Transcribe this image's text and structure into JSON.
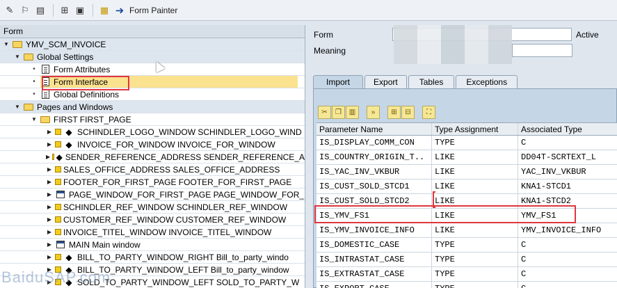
{
  "toolbar": {
    "form_painter_label": "Form Painter",
    "icons": [
      "pencil-glasses-icon",
      "activate-icon",
      "display-object-icon",
      "new-object-icon",
      "local-object-icon",
      "form-painter-icon"
    ]
  },
  "tree": {
    "header": "Form",
    "items": [
      {
        "label": "YMV_SCM_INVOICE",
        "level": 0,
        "icon": "folder-icon"
      },
      {
        "label": "Global Settings",
        "level": 1,
        "icon": "folder-icon"
      },
      {
        "label": "Form Attributes",
        "level": 2,
        "icon": "document-icon"
      },
      {
        "label": "Form Interface",
        "level": 2,
        "icon": "document-icon"
      },
      {
        "label": "Global Definitions",
        "level": 2,
        "icon": "document-icon"
      },
      {
        "label": "Pages and Windows",
        "level": 1,
        "icon": "folder-icon"
      },
      {
        "label": "FIRST FIRST_PAGE",
        "level": 2,
        "icon": "folder-icon"
      },
      {
        "label": "SCHINDLER_LOGO_WINDOW SCHINDLER_LOGO_WIND",
        "level": 3,
        "icon": "graphic-window-icon"
      },
      {
        "label": "INVOICE_FOR_WINDOW INVOICE_FOR_WINDOW",
        "level": 3,
        "icon": "graphic-window-icon"
      },
      {
        "label": "SENDER_REFERENCE_ADDRESS SENDER_REFERENCE_A",
        "level": 3,
        "icon": "graphic-window-icon"
      },
      {
        "label": "SALES_OFFICE_ADDRESS SALES_OFFICE_ADDRESS",
        "level": 3,
        "icon": "window-icon"
      },
      {
        "label": "FOOTER_FOR_FIRST_PAGE FOOTER_FOR_FIRST_PAGE",
        "level": 3,
        "icon": "window-icon"
      },
      {
        "label": "PAGE_WINDOW_FOR_FIRST_PAGE PAGE_WINDOW_FOR_",
        "level": 3,
        "icon": "window-icon"
      },
      {
        "label": "SCHINDLER_REF_WINDOW SCHINDLER_REF_WINDOW",
        "level": 3,
        "icon": "window-icon"
      },
      {
        "label": "CUSTOMER_REF_WINDOW CUSTOMER_REF_WINDOW",
        "level": 3,
        "icon": "window-icon"
      },
      {
        "label": "INVOICE_TITEL_WINDOW INVOICE_TITEL_WINDOW",
        "level": 3,
        "icon": "window-icon"
      },
      {
        "label": "MAIN Main window",
        "level": 3,
        "icon": "window-icon"
      },
      {
        "label": "BILL_TO_PARTY_WINDOW_RIGHT Bill_to_party_windo",
        "level": 3,
        "icon": "graphic-window-icon"
      },
      {
        "label": "BILL_TO_PARTY_WINDOW_LEFT Bill_to_party_window",
        "level": 3,
        "icon": "graphic-window-icon"
      },
      {
        "label": "SOLD_TO_PARTY_WINDOW_LEFT SOLD_TO_PARTY_W",
        "level": 3,
        "icon": "graphic-window-icon"
      }
    ]
  },
  "header_fields": {
    "form_label": "Form",
    "meaning_label": "Meaning",
    "status": "Active"
  },
  "tabs": [
    {
      "label": "Import"
    },
    {
      "label": "Export"
    },
    {
      "label": "Tables"
    },
    {
      "label": "Exceptions"
    }
  ],
  "table": {
    "columns": [
      "Parameter Name",
      "Type Assignment",
      "Associated Type"
    ],
    "rows": [
      [
        "IS_DISPLAY_COMM_CON",
        "TYPE",
        "C"
      ],
      [
        "IS_COUNTRY_ORIGIN_T..",
        "LIKE",
        "DD04T-SCRTEXT_L"
      ],
      [
        "IS_YAC_INV_VKBUR",
        "LIKE",
        "YAC_INV_VKBUR"
      ],
      [
        "IS_CUST_SOLD_STCD1",
        "LIKE",
        "KNA1-STCD1"
      ],
      [
        "IS_CUST_SOLD_STCD2",
        "LIKE",
        "KNA1-STCD2"
      ],
      [
        "IS_YMV_FS1",
        "LIKE",
        "YMV_FS1"
      ],
      [
        "IS_YMV_INVOICE_INFO",
        "LIKE",
        "YMV_INVOICE_INFO"
      ],
      [
        "IS_DOMESTIC_CASE",
        "TYPE",
        "C"
      ],
      [
        "IS_INTRASTAT_CASE",
        "TYPE",
        "C"
      ],
      [
        "IS_EXTRASTAT_CASE",
        "TYPE",
        "C"
      ],
      [
        "IS_EXPORT_CASE",
        "TYPE",
        "C"
      ]
    ]
  },
  "watermark": "BaiduSAP.com"
}
